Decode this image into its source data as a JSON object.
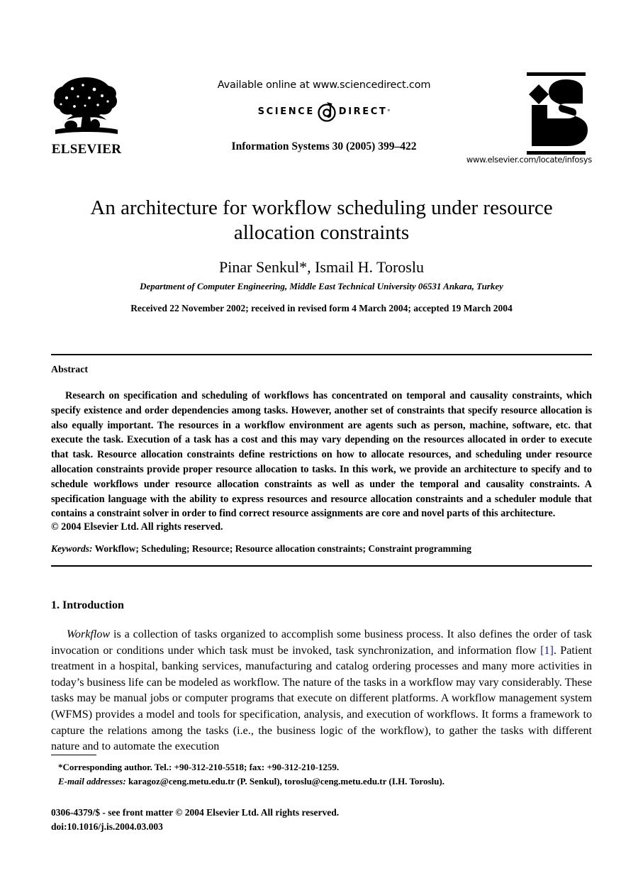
{
  "masthead": {
    "publisher_name": "ELSEVIER",
    "available_online": "Available online at www.sciencedirect.com",
    "sciencedirect_left": "SCIENCE",
    "sciencedirect_right": "DIRECT",
    "sciencedirect_sup": "°",
    "journal_reference": "Information Systems 30 (2005) 399–422",
    "journal_logo_text": "iS",
    "journal_url": "www.elsevier.com/locate/infosys"
  },
  "article": {
    "title": "An architecture for workflow scheduling under resource allocation constraints",
    "authors": "Pinar Senkul*, Ismail H. Toroslu",
    "affiliation": "Department of Computer Engineering, Middle East Technical University 06531 Ankara, Turkey",
    "dates": "Received 22 November 2002; received in revised form 4 March 2004; accepted 19 March 2004"
  },
  "abstract": {
    "heading": "Abstract",
    "body": "Research on specification and scheduling of workflows has concentrated on temporal and causality constraints, which specify existence and order dependencies among tasks. However, another set of constraints that specify resource allocation is also equally important. The resources in a workflow environment are agents such as person, machine, software, etc. that execute the task. Execution of a task has a cost and this may vary depending on the resources allocated in order to execute that task. Resource allocation constraints define restrictions on how to allocate resources, and scheduling under resource allocation constraints provide proper resource allocation to tasks. In this work, we provide an architecture to specify and to schedule workflows under resource allocation constraints as well as under the temporal and causality constraints. A specification language with the ability to express resources and resource allocation constraints and a scheduler module that contains a constraint solver in order to find correct resource assignments are core and novel parts of this architecture.",
    "copyright": "© 2004 Elsevier Ltd. All rights reserved.",
    "keywords_label": "Keywords:",
    "keywords_value": "Workflow; Scheduling; Resource; Resource allocation constraints; Constraint programming"
  },
  "introduction": {
    "heading": "1. Introduction",
    "lead_italic": "Workflow",
    "text_part_1": " is a collection of tasks organized to accomplish some business process. It also defines the order of task invocation or conditions under which task must be invoked, task synchronization, and information flow ",
    "reference_link": "[1]",
    "text_part_2": ". Patient treatment in a hospital, banking services, manufacturing and catalog ordering processes and many more activities in today’s business life can be modeled as workflow. The nature of the tasks in a workflow may vary considerably. These tasks may be manual jobs or computer programs that execute on different platforms. A workflow management system (WFMS) provides a model and tools for specification, analysis, and execution of workflows. It forms a framework to capture the relations among the tasks (i.e., the business logic of the workflow), to gather the tasks with different nature and to automate the execution"
  },
  "footnotes": {
    "corresponding_author": "*Corresponding author. Tel.: +90-312-210-5518; fax: +90-312-210-1259.",
    "email_label": "E-mail addresses:",
    "email_value": " karagoz@ceng.metu.edu.tr (P. Senkul), toroslu@ceng.metu.edu.tr (I.H. Toroslu)."
  },
  "imprint": {
    "line1": "0306-4379/$ - see front matter © 2004 Elsevier Ltd. All rights reserved.",
    "line2": "doi:10.1016/j.is.2004.03.003"
  },
  "colors": {
    "text": "#000000",
    "reference_link": "#1a1a8c",
    "rule": "#000000",
    "background": "#ffffff"
  }
}
